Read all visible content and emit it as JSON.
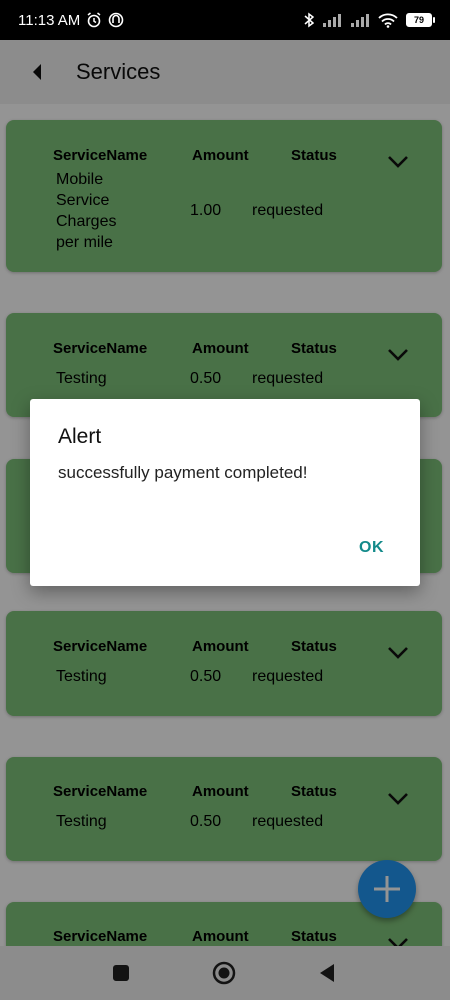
{
  "status_bar": {
    "time": "11:13 AM",
    "battery": "79"
  },
  "app_bar": {
    "title": "Services"
  },
  "headers": {
    "service": "ServiceName",
    "amount": "Amount",
    "status": "Status"
  },
  "services": [
    {
      "service": "Mobile Service Charges per mile",
      "amount": "1.00",
      "status": "requested"
    },
    {
      "service": "Testing",
      "amount": "0.50",
      "status": "requested"
    },
    {
      "service": "",
      "amount": "",
      "status": ""
    },
    {
      "service": "Testing",
      "amount": "0.50",
      "status": "requested"
    },
    {
      "service": "Testing",
      "amount": "0.50",
      "status": "requested"
    },
    {
      "service": "",
      "amount": "",
      "status": ""
    }
  ],
  "dialog": {
    "title": "Alert",
    "message": "successfully payment completed!",
    "ok_label": "OK"
  },
  "colors": {
    "card": "#7fc37a",
    "fab": "#2196f3",
    "ok": "#138a8a"
  }
}
